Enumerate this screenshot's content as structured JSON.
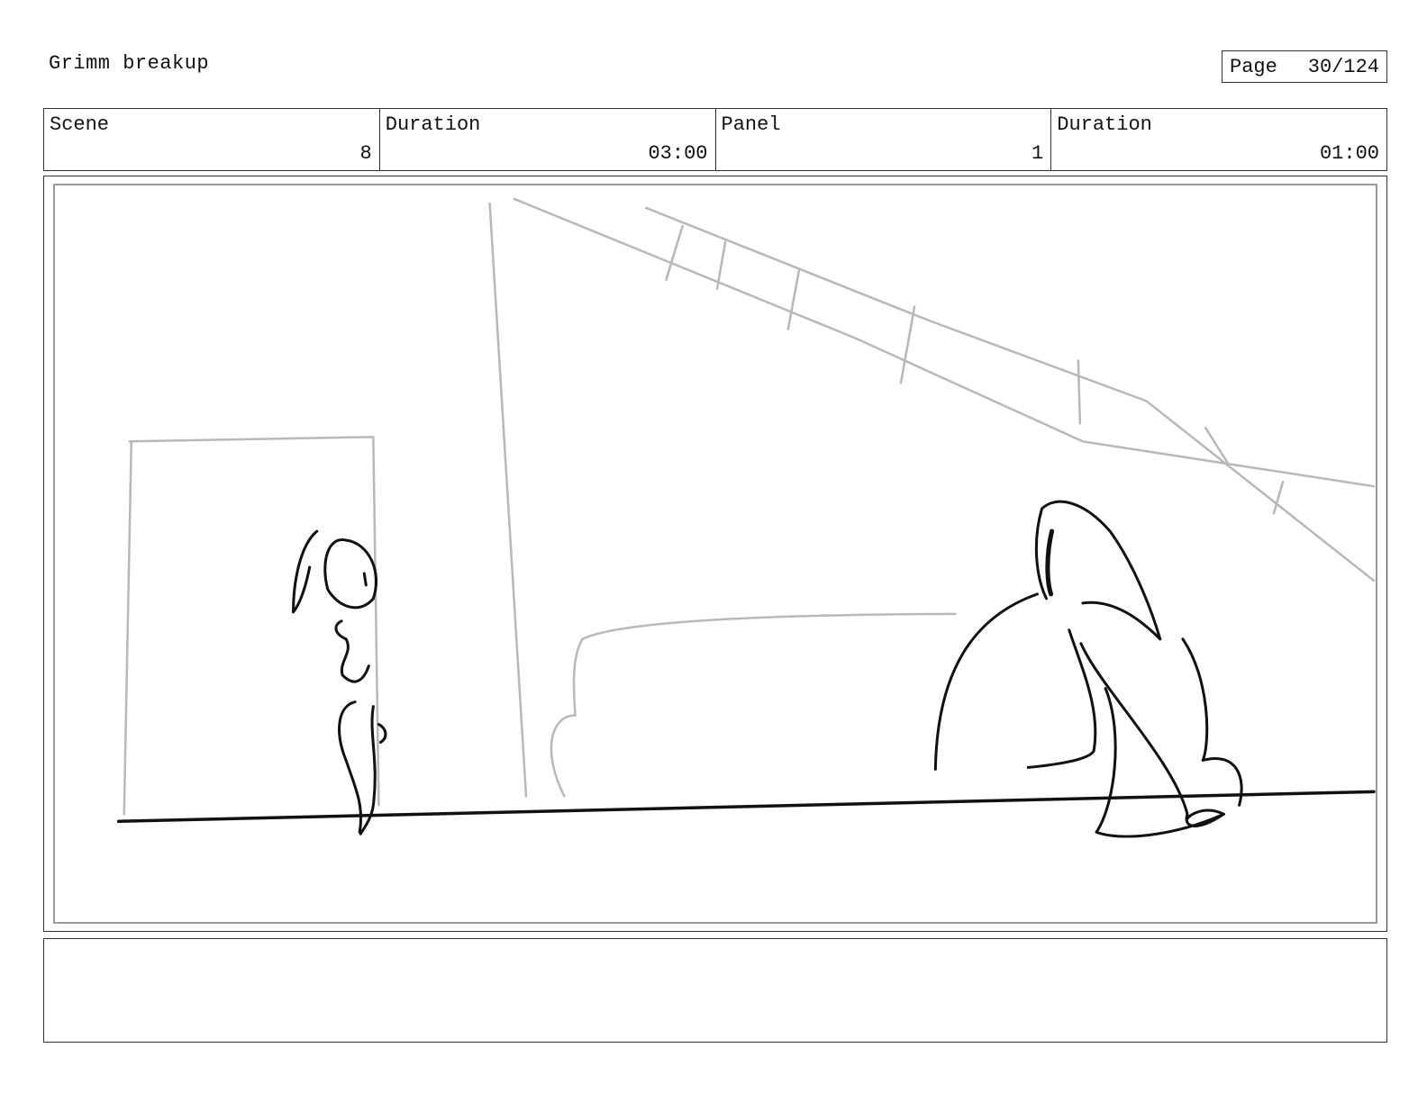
{
  "header": {
    "title": "Grimm breakup",
    "page_label": "Page",
    "page_value": "30/124"
  },
  "info": {
    "scene_label": "Scene",
    "scene_value": "8",
    "scene_duration_label": "Duration",
    "scene_duration_value": "03:00",
    "panel_label": "Panel",
    "panel_value": "1",
    "panel_duration_label": "Duration",
    "panel_duration_value": "01:00"
  },
  "notes": {
    "text": ""
  },
  "colors": {
    "sketch_light": "#b8b8b8",
    "sketch_dark": "#111111",
    "frame": "#333333"
  }
}
